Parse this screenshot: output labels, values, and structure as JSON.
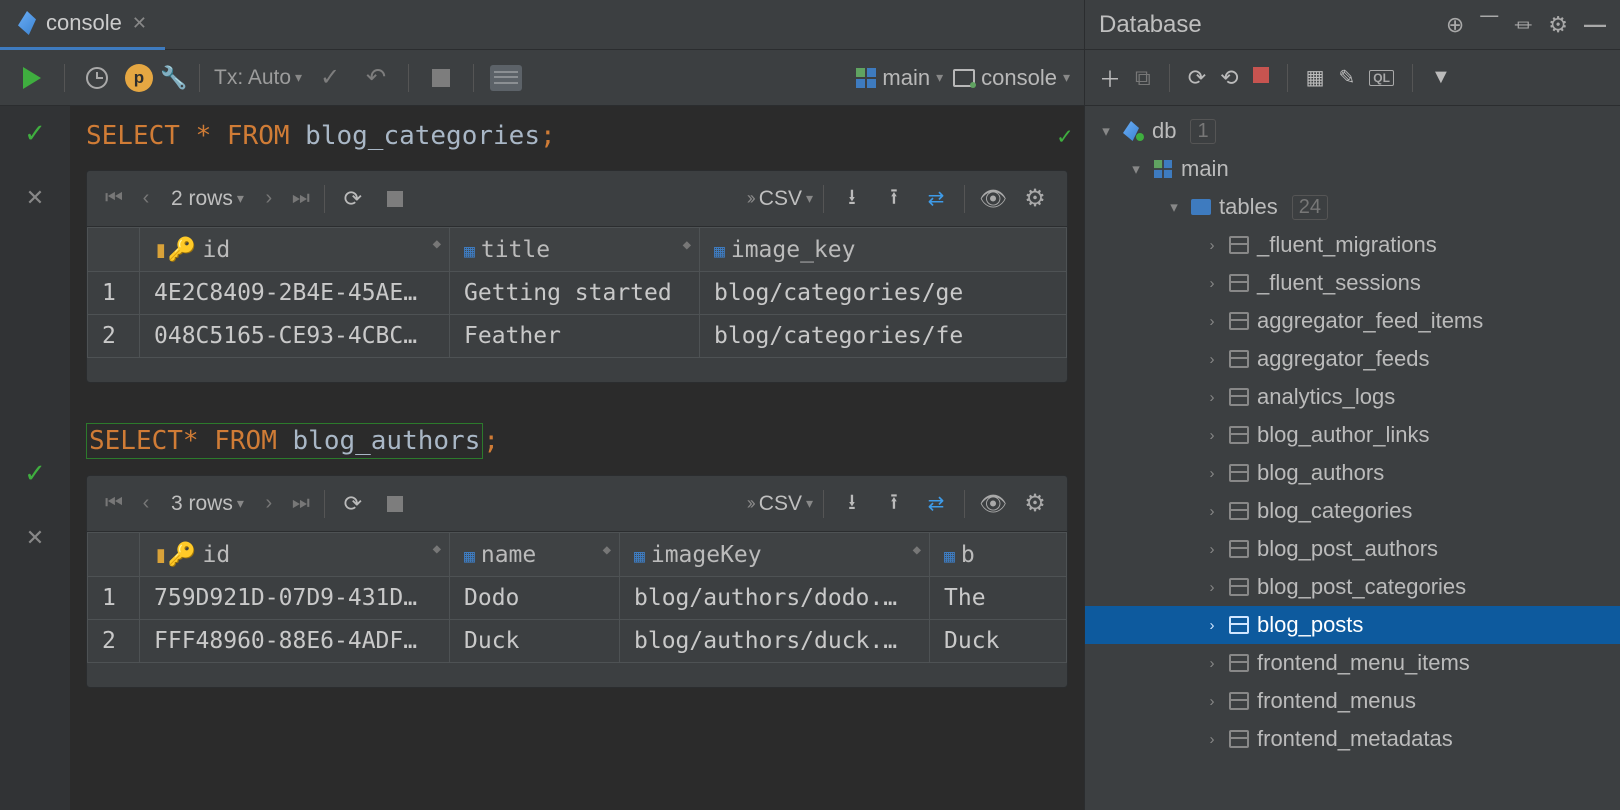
{
  "tab": {
    "label": "console"
  },
  "toolbar": {
    "tx_label": "Tx: Auto",
    "schema_label": "main",
    "console_label": "console"
  },
  "query1": {
    "sql_kw1": "SELECT",
    "sql_star": "*",
    "sql_kw2": "FROM",
    "sql_tbl": "blog_categories",
    "sql_sc": ";",
    "rowcount": "2 rows",
    "csv": "CSV",
    "headers": {
      "h1": "id",
      "h2": "title",
      "h3": "image_key"
    },
    "rows": [
      {
        "n": "1",
        "id": "4E2C8409-2B4E-45AE…",
        "title": "Getting started",
        "image_key": "blog/categories/ge"
      },
      {
        "n": "2",
        "id": "048C5165-CE93-4CBC…",
        "title": "Feather",
        "image_key": "blog/categories/fe"
      }
    ]
  },
  "query2": {
    "sql_kw1": "SELECT",
    "sql_star": "*",
    "sql_kw2": "FROM",
    "sql_tbl": "blog_authors",
    "sql_sc": ";",
    "rowcount": "3 rows",
    "csv": "CSV",
    "headers": {
      "h1": "id",
      "h2": "name",
      "h3": "imageKey",
      "h4": "b"
    },
    "rows": [
      {
        "n": "1",
        "id": "759D921D-07D9-431D…",
        "name": "Dodo",
        "imageKey": "blog/authors/dodo.…",
        "b": "The"
      },
      {
        "n": "2",
        "id": "FFF48960-88E6-4ADF…",
        "name": "Duck",
        "imageKey": "blog/authors/duck.…",
        "b": "Duck"
      }
    ]
  },
  "database": {
    "panel_title": "Database",
    "root": "db",
    "root_count": "1",
    "schema": "main",
    "tables_label": "tables",
    "tables_count": "24",
    "tables": [
      "_fluent_migrations",
      "_fluent_sessions",
      "aggregator_feed_items",
      "aggregator_feeds",
      "analytics_logs",
      "blog_author_links",
      "blog_authors",
      "blog_categories",
      "blog_post_authors",
      "blog_post_categories",
      "blog_posts",
      "frontend_menu_items",
      "frontend_menus",
      "frontend_metadatas"
    ],
    "selected": "blog_posts"
  }
}
